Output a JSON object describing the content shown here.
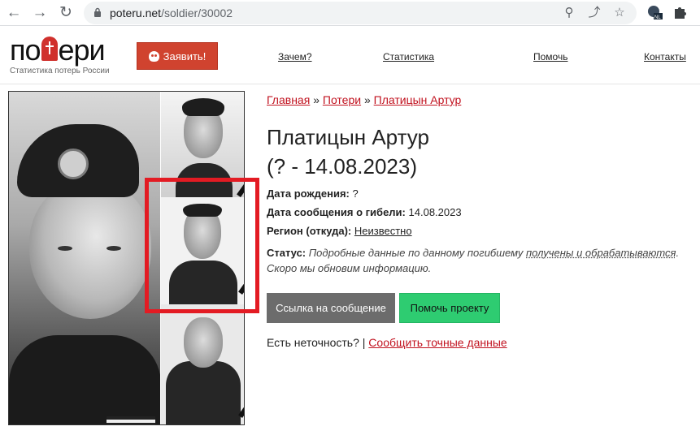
{
  "browser": {
    "url_host": "poteru.net",
    "url_path": "/soldier/30002",
    "back_icon": "arrow-left-icon",
    "forward_icon": "arrow-right-icon",
    "reload_icon": "refresh-icon"
  },
  "site": {
    "logo_left": "по",
    "logo_right": "ери",
    "tagline": "Статистика потерь России",
    "declare_button": "Заявить!",
    "nav": [
      "Зачем?",
      "Статистика",
      "Помочь",
      "Контакты"
    ]
  },
  "breadcrumbs": [
    "Главная",
    "Потери",
    "Платицын Артур"
  ],
  "breadcrumb_sep": "»",
  "person": {
    "name": "Платицын Артур",
    "dates": "(? - 14.08.2023)",
    "birth_label": "Дата рождения:",
    "birth_value": "?",
    "death_label": "Дата сообщения о гибели:",
    "death_value": "14.08.2023",
    "region_label": "Регион (откуда):",
    "region_value": "Неизвестно",
    "status_label": "Статус:",
    "status_text_1": "Подробные данные по данному погибшему",
    "status_link": "получены и обрабатываются",
    "status_text_2": ". Скоро мы обновим информацию."
  },
  "buttons": {
    "source_link": "Ссылка на сообщение",
    "help_project": "Помочь проекту"
  },
  "inaccuracy": {
    "question": "Есть неточность?",
    "sep": "|",
    "report_link": "Сообщить точные данные"
  },
  "colors": {
    "accent_red": "#c1121f",
    "highlight_red": "#e31b23",
    "green": "#2ecc71",
    "grey_button": "#6c6c6c"
  }
}
